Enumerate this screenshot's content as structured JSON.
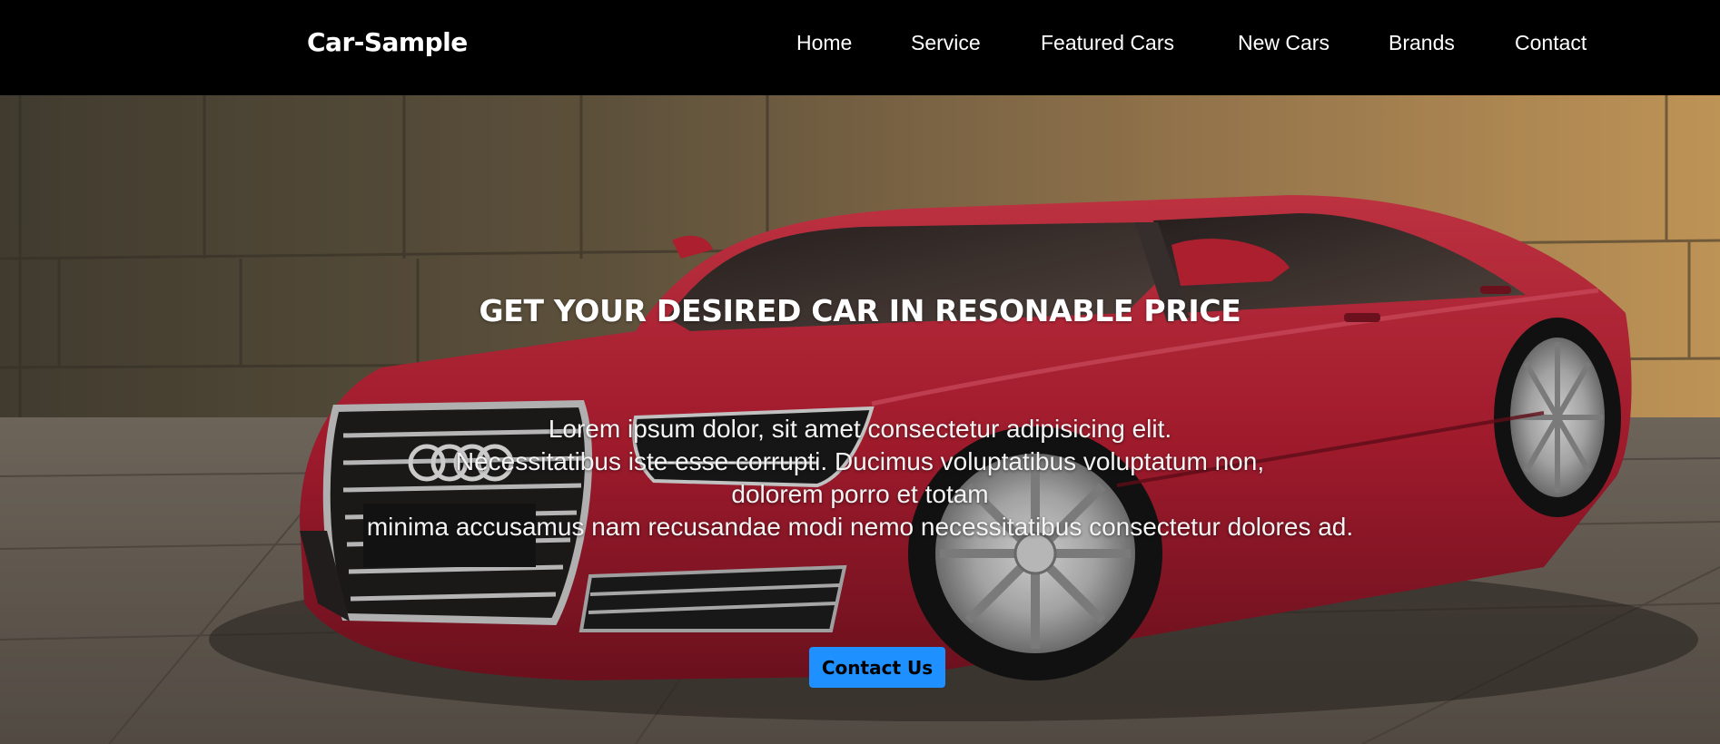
{
  "navbar": {
    "brand": "Car-Sample",
    "links": [
      {
        "label": "Home"
      },
      {
        "label": "Service"
      },
      {
        "label": "Featured Cars"
      },
      {
        "label": "New Cars"
      },
      {
        "label": "Brands"
      },
      {
        "label": "Contact"
      }
    ]
  },
  "hero": {
    "heading": "GET YOUR DESIRED CAR IN RESONABLE PRICE",
    "text_lines": [
      "Lorem ipsum dolor, sit amet consectetur adipisicing elit.",
      "Necessitatibus iste esse corrupti. Ducimus voluptatibus voluptatum non,",
      "dolorem porro et totam",
      "minima accusamus nam recusandae modi nemo necessitatibus consectetur dolores ad."
    ],
    "button_label": "Contact Us",
    "background_image": "red-sedan-car-photo"
  },
  "colors": {
    "navbar_bg": "#000000",
    "accent": "#1e90ff",
    "car_red": "#c8283a"
  }
}
